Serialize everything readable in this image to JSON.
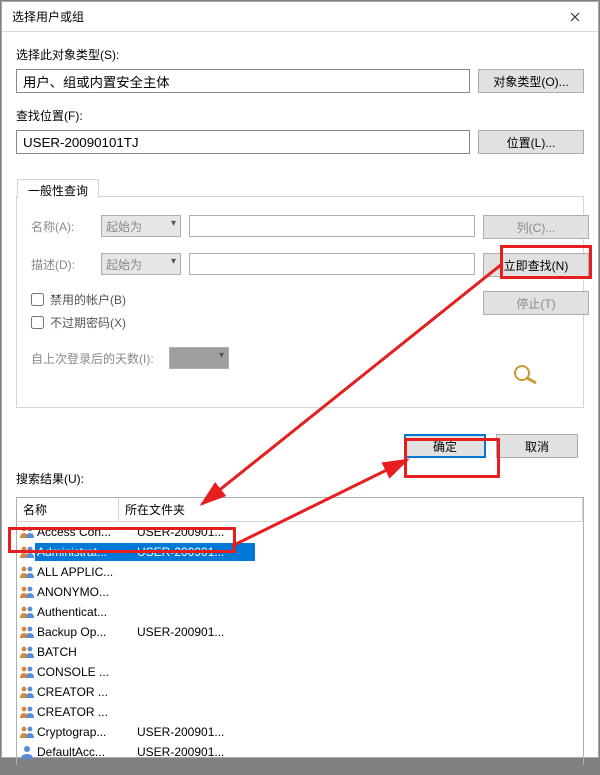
{
  "window": {
    "title": "选择用户或组"
  },
  "object_type": {
    "label": "选择此对象类型(S):",
    "value": "用户、组或内置安全主体",
    "button": "对象类型(O)..."
  },
  "location": {
    "label": "查找位置(F):",
    "value": "USER-20090101TJ",
    "button": "位置(L)..."
  },
  "tab": {
    "common_query": "一般性查询",
    "name_label": "名称(A):",
    "desc_label": "描述(D):",
    "starts_with": "起始为",
    "disabled_accounts": "禁用的帐户(B)",
    "non_expiring_pw": "不过期密码(X)",
    "days_since_login": "自上次登录后的天数(I):"
  },
  "sidebar_buttons": {
    "columns": "列(C)...",
    "find_now": "立即查找(N)",
    "stop": "停止(T)"
  },
  "footer": {
    "ok": "确定",
    "cancel": "取消"
  },
  "results_label": "搜索结果(U):",
  "results_headers": {
    "name": "名称",
    "folder": "所在文件夹"
  },
  "results": [
    {
      "name": "Access Con...",
      "folder": "USER-200901...",
      "icon": "group"
    },
    {
      "name": "Administrat...",
      "folder": "USER-200901...",
      "icon": "group",
      "selected": true
    },
    {
      "name": "ALL APPLIC...",
      "folder": "",
      "icon": "group"
    },
    {
      "name": "ANONYMO...",
      "folder": "",
      "icon": "group"
    },
    {
      "name": "Authenticat...",
      "folder": "",
      "icon": "group"
    },
    {
      "name": "Backup Op...",
      "folder": "USER-200901...",
      "icon": "group"
    },
    {
      "name": "BATCH",
      "folder": "",
      "icon": "group"
    },
    {
      "name": "CONSOLE ...",
      "folder": "",
      "icon": "group"
    },
    {
      "name": "CREATOR ...",
      "folder": "",
      "icon": "group"
    },
    {
      "name": "CREATOR ...",
      "folder": "",
      "icon": "group"
    },
    {
      "name": "Cryptograp...",
      "folder": "USER-200901...",
      "icon": "group"
    },
    {
      "name": "DefaultAcc...",
      "folder": "USER-200901...",
      "icon": "user"
    }
  ]
}
